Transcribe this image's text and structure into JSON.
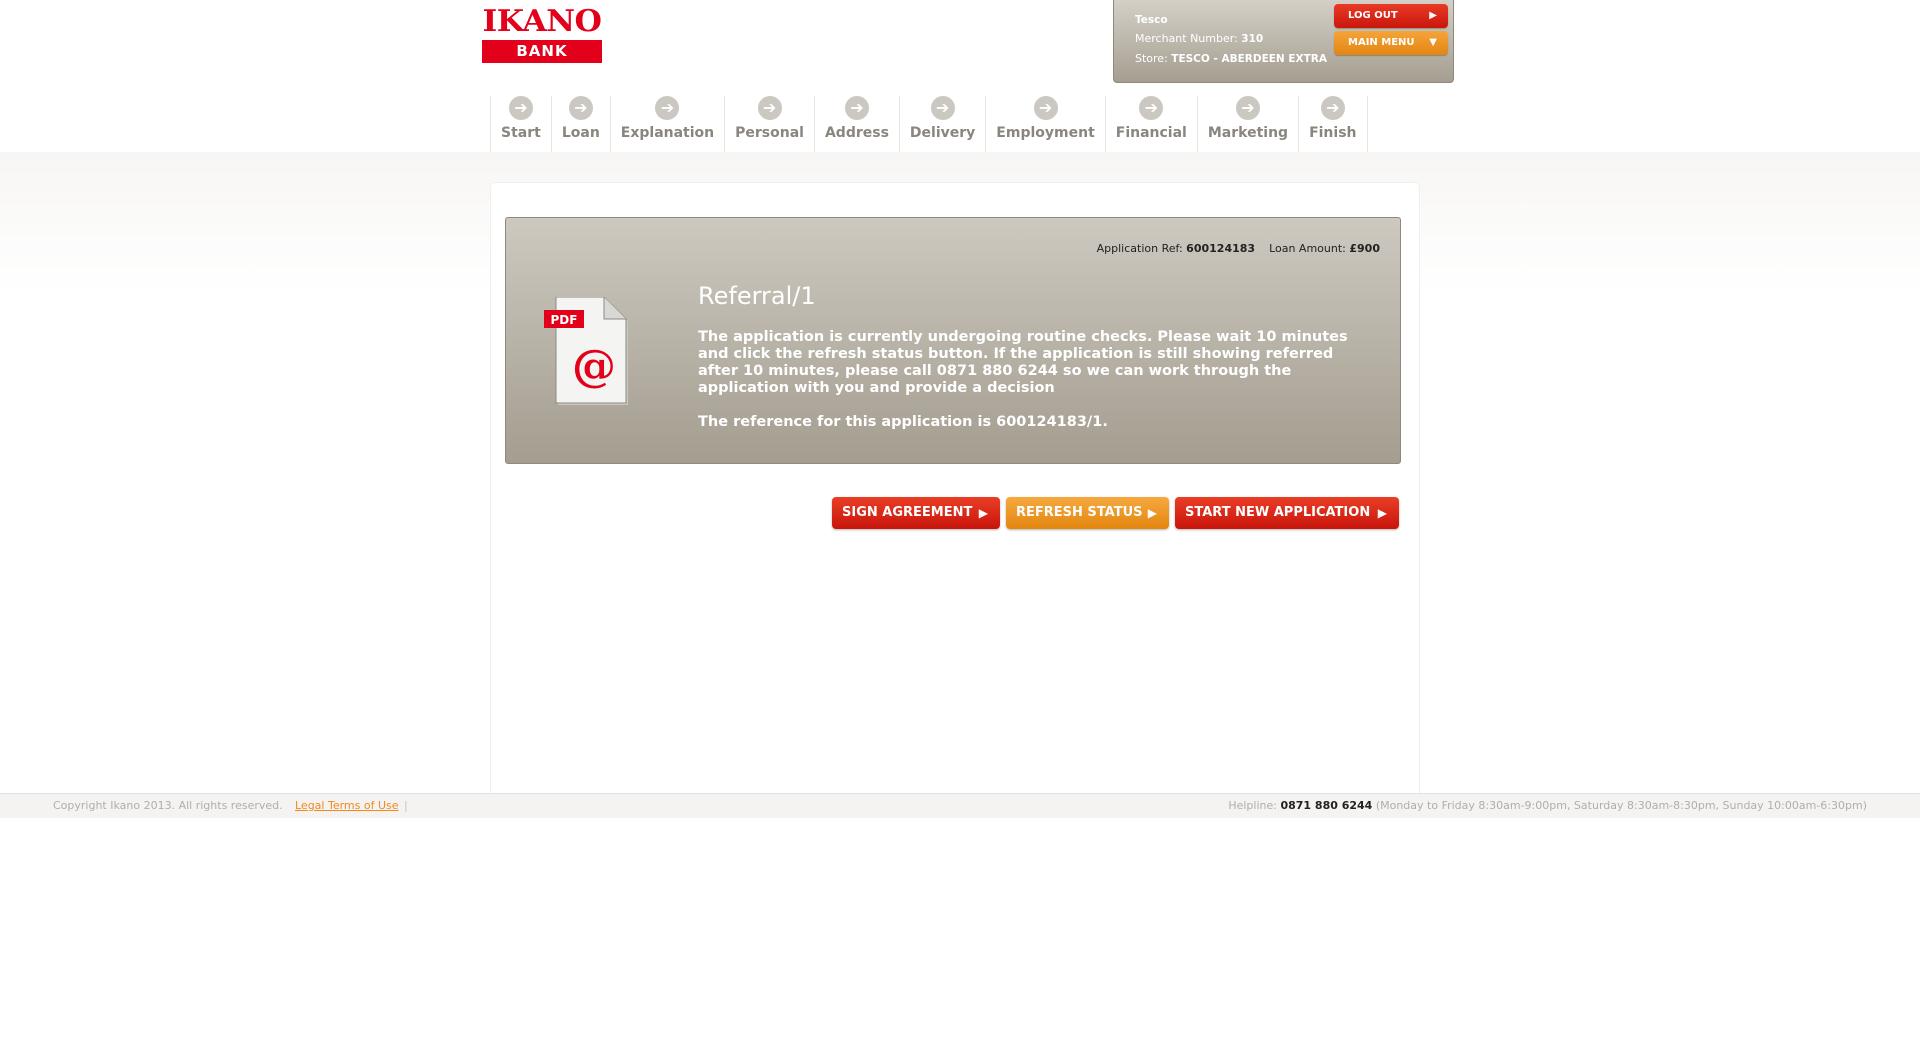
{
  "header": {
    "logo_top": "IKANO",
    "logo_bottom": "BANK",
    "merchant_name": "Tesco",
    "merchant_number_label": "Merchant Number:",
    "merchant_number": "310",
    "store_label": "Store:",
    "store_value": "TESCO - ABERDEEN EXTRA",
    "logout_label": "LOG OUT",
    "main_menu_label": "MAIN MENU"
  },
  "steps": [
    {
      "label": "Start"
    },
    {
      "label": "Loan"
    },
    {
      "label": "Explanation"
    },
    {
      "label": "Personal"
    },
    {
      "label": "Address"
    },
    {
      "label": "Delivery"
    },
    {
      "label": "Employment"
    },
    {
      "label": "Financial"
    },
    {
      "label": "Marketing"
    },
    {
      "label": "Finish"
    }
  ],
  "status": {
    "app_ref_label": "Application Ref:",
    "app_ref": "600124183",
    "loan_amount_label": "Loan Amount:",
    "loan_amount": "£900",
    "icon_badge": "PDF",
    "title": "Referral/1",
    "message": "The application is currently undergoing routine checks. Please wait 10 minutes and click the refresh status button. If the application is still showing referred after 10 minutes, please call 0871 880 6244 so we can work through the application with you and provide a decision",
    "reference_text": "The reference for this application is 600124183/1."
  },
  "actions": {
    "sign_agreement": "SIGN AGREEMENT",
    "refresh_status": "REFRESH STATUS",
    "start_new_application": "START NEW APPLICATION"
  },
  "footer": {
    "copyright": "Copyright Ikano 2013. All rights reserved.",
    "legal_link": "Legal Terms of Use",
    "separator": "|",
    "helpline_label": "Helpline:",
    "helpline_number": "0871 880 6244",
    "helpline_hours": "(Monday to Friday 8:30am-9:00pm, Saturday 8:30am-8:30pm, Sunday 10:00am-6:30pm)"
  },
  "colors": {
    "brand_red": "#e2001a",
    "accent_orange": "#e3860f",
    "panel_grey": "#a49d90"
  }
}
